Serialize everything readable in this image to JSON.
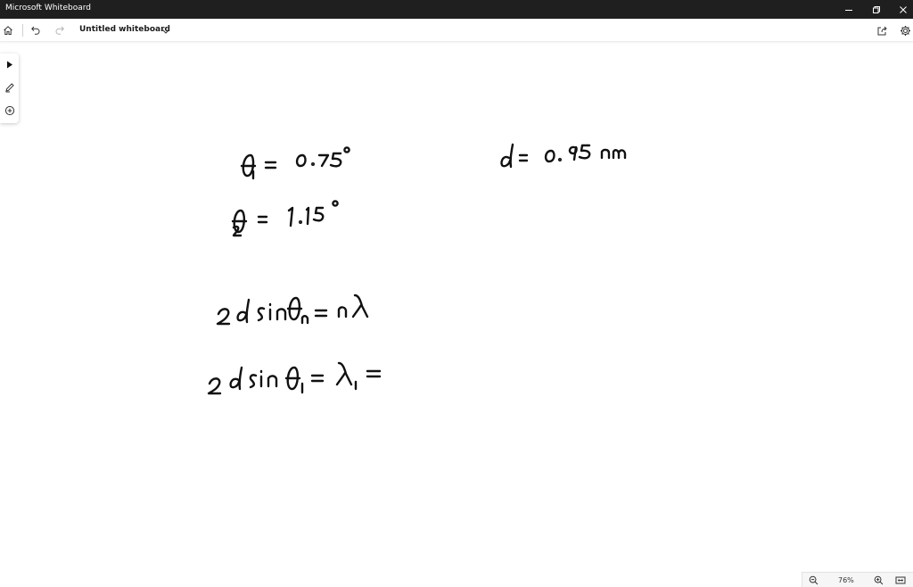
{
  "window": {
    "title": "Microsoft Whiteboard"
  },
  "toolbar": {
    "board_title": "Untitled whiteboard"
  },
  "icons": {
    "home": "home-icon",
    "undo": "undo-icon",
    "redo": "redo-icon",
    "share": "share-icon",
    "settings": "gear-icon",
    "select": "pointer-icon",
    "pen": "pen-icon",
    "add": "add-circle-icon",
    "zoom_out": "zoom-out-icon",
    "zoom_in": "zoom-in-icon",
    "fit": "fit-screen-icon"
  },
  "zoom": {
    "level": "76%"
  },
  "colors": {
    "titlebar": "#1f1f1f",
    "ink": "#111111",
    "canvas": "#ffffff"
  }
}
